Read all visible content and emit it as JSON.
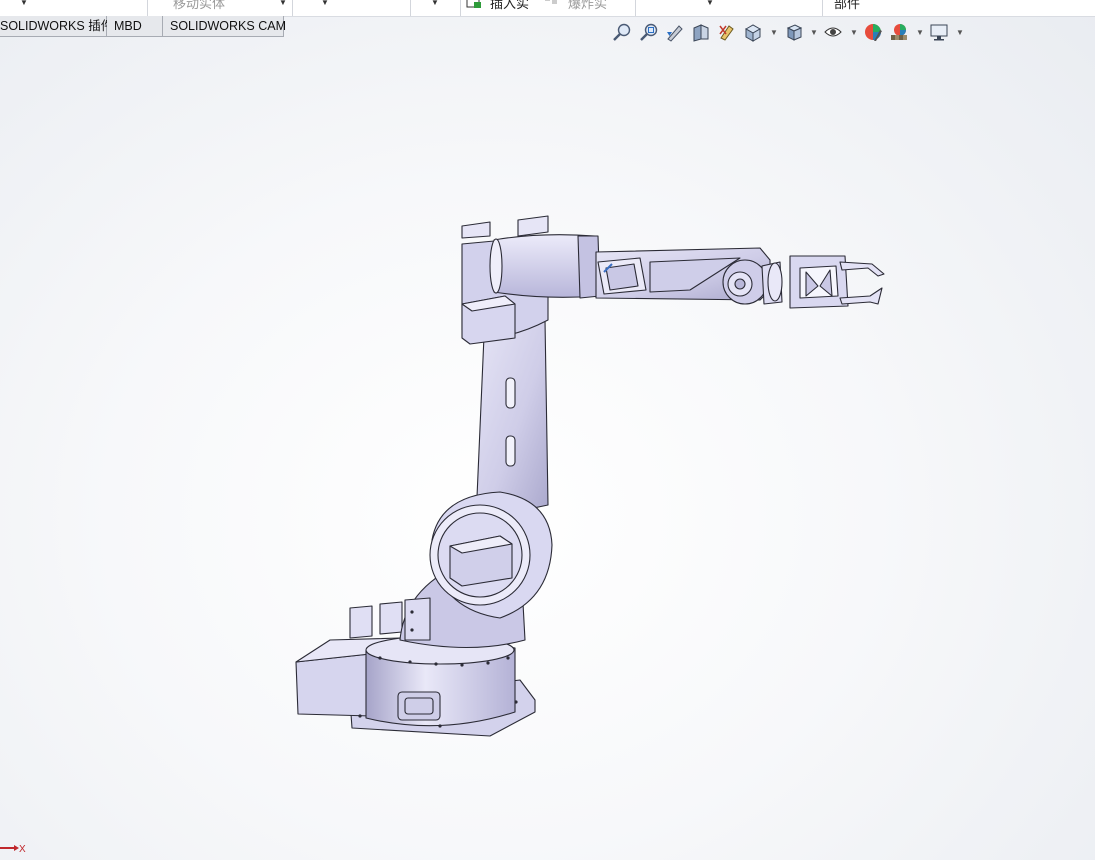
{
  "ribbon": {
    "move_body_label": "移动实体",
    "insert_part_label": "插入实",
    "exploded_label": "爆炸实",
    "part_label": "部件"
  },
  "tabs": [
    {
      "label": "SOLIDWORKS 插件"
    },
    {
      "label": "MBD"
    },
    {
      "label": "SOLIDWORKS CAM"
    }
  ],
  "hud_toolbar": {
    "icons": [
      "zoom-to-fit-icon",
      "zoom-to-area-icon",
      "previous-view-icon",
      "section-view-icon",
      "dynamic-annotation-icon",
      "view-orientation-icon",
      "display-style-icon",
      "hide-show-items-icon",
      "edit-appearance-icon",
      "apply-scene-icon",
      "view-settings-icon"
    ]
  },
  "model": {
    "name": "six-axis industrial robot arm with gripper",
    "body_color": "#d7d6ee",
    "edge_color": "#2b2b36"
  },
  "triad": {
    "x_label": "X",
    "x_color": "#c0282d"
  }
}
